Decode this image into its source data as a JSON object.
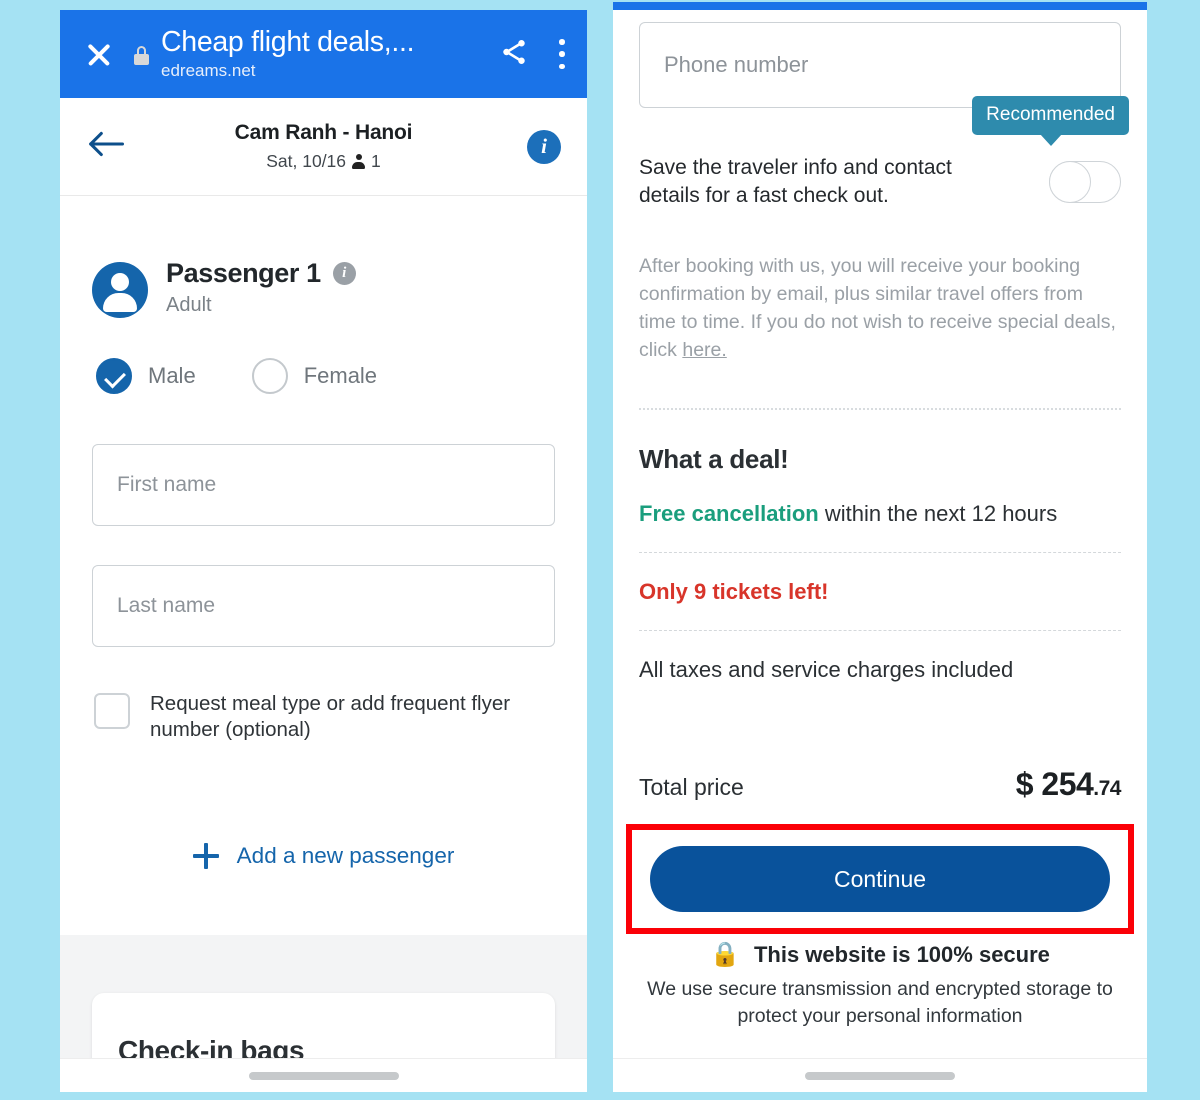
{
  "browser": {
    "close_icon": "close-icon",
    "lock_icon": "lock-icon",
    "title": "Cheap flight deals,...",
    "host": "edreams.net",
    "share_icon": "share-icon",
    "menu_icon": "more-vertical-icon"
  },
  "subheader": {
    "back_icon": "back-arrow-icon",
    "route": "Cam Ranh - Hanoi",
    "date": "Sat, 10/16",
    "passenger_icon": "person-icon",
    "passenger_count": "1",
    "info_icon": "info-icon",
    "info_label": "i"
  },
  "passenger": {
    "avatar_icon": "avatar-icon",
    "name": "Passenger 1",
    "info_label": "i",
    "type": "Adult",
    "gender": {
      "selected": "Male",
      "options": [
        {
          "label": "Male",
          "checked": true
        },
        {
          "label": "Female",
          "checked": false
        }
      ]
    },
    "first_name": {
      "placeholder": "First name",
      "value": ""
    },
    "last_name": {
      "placeholder": "Last name",
      "value": ""
    },
    "meal_option": {
      "label": "Request meal type or add frequent flyer number (optional)",
      "checked": false
    },
    "add_passenger_label": "Add a new passenger"
  },
  "bags": {
    "title": "Check-in bags"
  },
  "contact": {
    "phone": {
      "placeholder": "Phone number",
      "value": ""
    },
    "save_label": "Save the traveler info and contact details for a fast check out.",
    "recommended_badge": "Recommended",
    "toggle_state": "off",
    "legal_text": "After booking with us, you will receive your booking confirmation by email, plus similar travel offers from time to time. If you do not wish to receive special deals, click ",
    "legal_link": "here."
  },
  "deal": {
    "title": "What a deal!",
    "items": [
      {
        "highlight": "Free cancellation",
        "highlight_color": "green",
        "rest": " within the next 12 hours"
      },
      {
        "highlight": "Only 9 tickets left!",
        "highlight_color": "red",
        "rest": ""
      },
      {
        "highlight": "",
        "highlight_color": "none",
        "rest": "All taxes and service charges included"
      }
    ]
  },
  "total": {
    "label": "Total price",
    "currency": "$",
    "whole": "254",
    "cents": ".74"
  },
  "cta": {
    "label": "Continue",
    "highlight_color": "#fb0007"
  },
  "secure": {
    "lock_icon": "lock-emoji-icon",
    "headline": "This website is 100% secure",
    "subtext": "We use secure transmission and encrypted storage to protect your personal information"
  },
  "colors": {
    "page_background": "#a5e2f3",
    "browser_blue": "#1a73e8",
    "brand_blue": "#1565ab",
    "cta_blue": "#09529b",
    "badge_teal": "#2e8bad",
    "green": "#1a9e7d",
    "red": "#d8352a"
  }
}
